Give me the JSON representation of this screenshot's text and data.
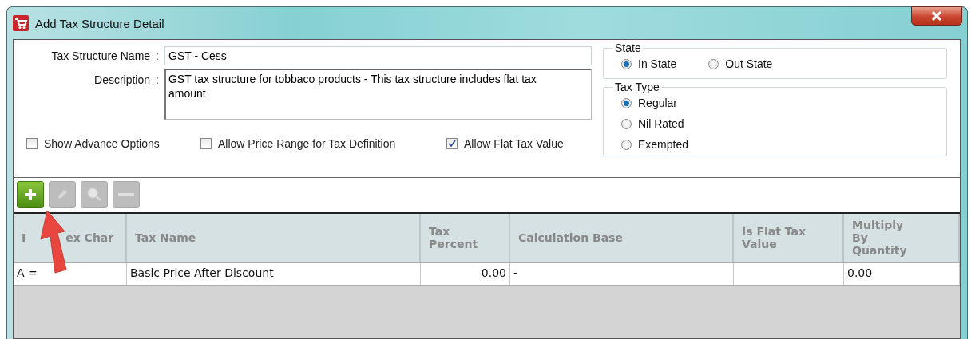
{
  "window": {
    "title": "Add Tax Structure Detail"
  },
  "form": {
    "name_label": "Tax Structure Name",
    "name_value": "GST - Cess",
    "separator": ":",
    "description_label": "Description",
    "description_value": "GST tax structure for tobbaco products - This tax structure includes flat tax amount"
  },
  "options": [
    {
      "label": "Show Advance Options",
      "checked": false
    },
    {
      "label": "Allow Price Range for Tax Definition",
      "checked": false
    },
    {
      "label": "Allow Flat Tax Value",
      "checked": true
    }
  ],
  "state_group": {
    "title": "State",
    "options": [
      {
        "label": "In State",
        "selected": true
      },
      {
        "label": "Out State",
        "selected": false
      }
    ]
  },
  "tax_type_group": {
    "title": "Tax Type",
    "options": [
      {
        "label": "Regular",
        "selected": true
      },
      {
        "label": "Nil Rated",
        "selected": false
      },
      {
        "label": "Exempted",
        "selected": false
      }
    ]
  },
  "toolbar": [
    {
      "kind": "add",
      "disabled": false
    },
    {
      "kind": "edit",
      "disabled": true
    },
    {
      "kind": "view",
      "disabled": true
    },
    {
      "kind": "remove",
      "disabled": true
    }
  ],
  "table": {
    "columns": [
      [
        "I",
        "ex Char"
      ],
      "Tax Name",
      "Tax Percent",
      "Calculation Base",
      "Is Flat Tax Value",
      "Multiply By Quantity"
    ],
    "rows": [
      [
        "A =",
        "Basic Price After Discount",
        "0.00",
        "-",
        "",
        "0.00"
      ]
    ]
  }
}
